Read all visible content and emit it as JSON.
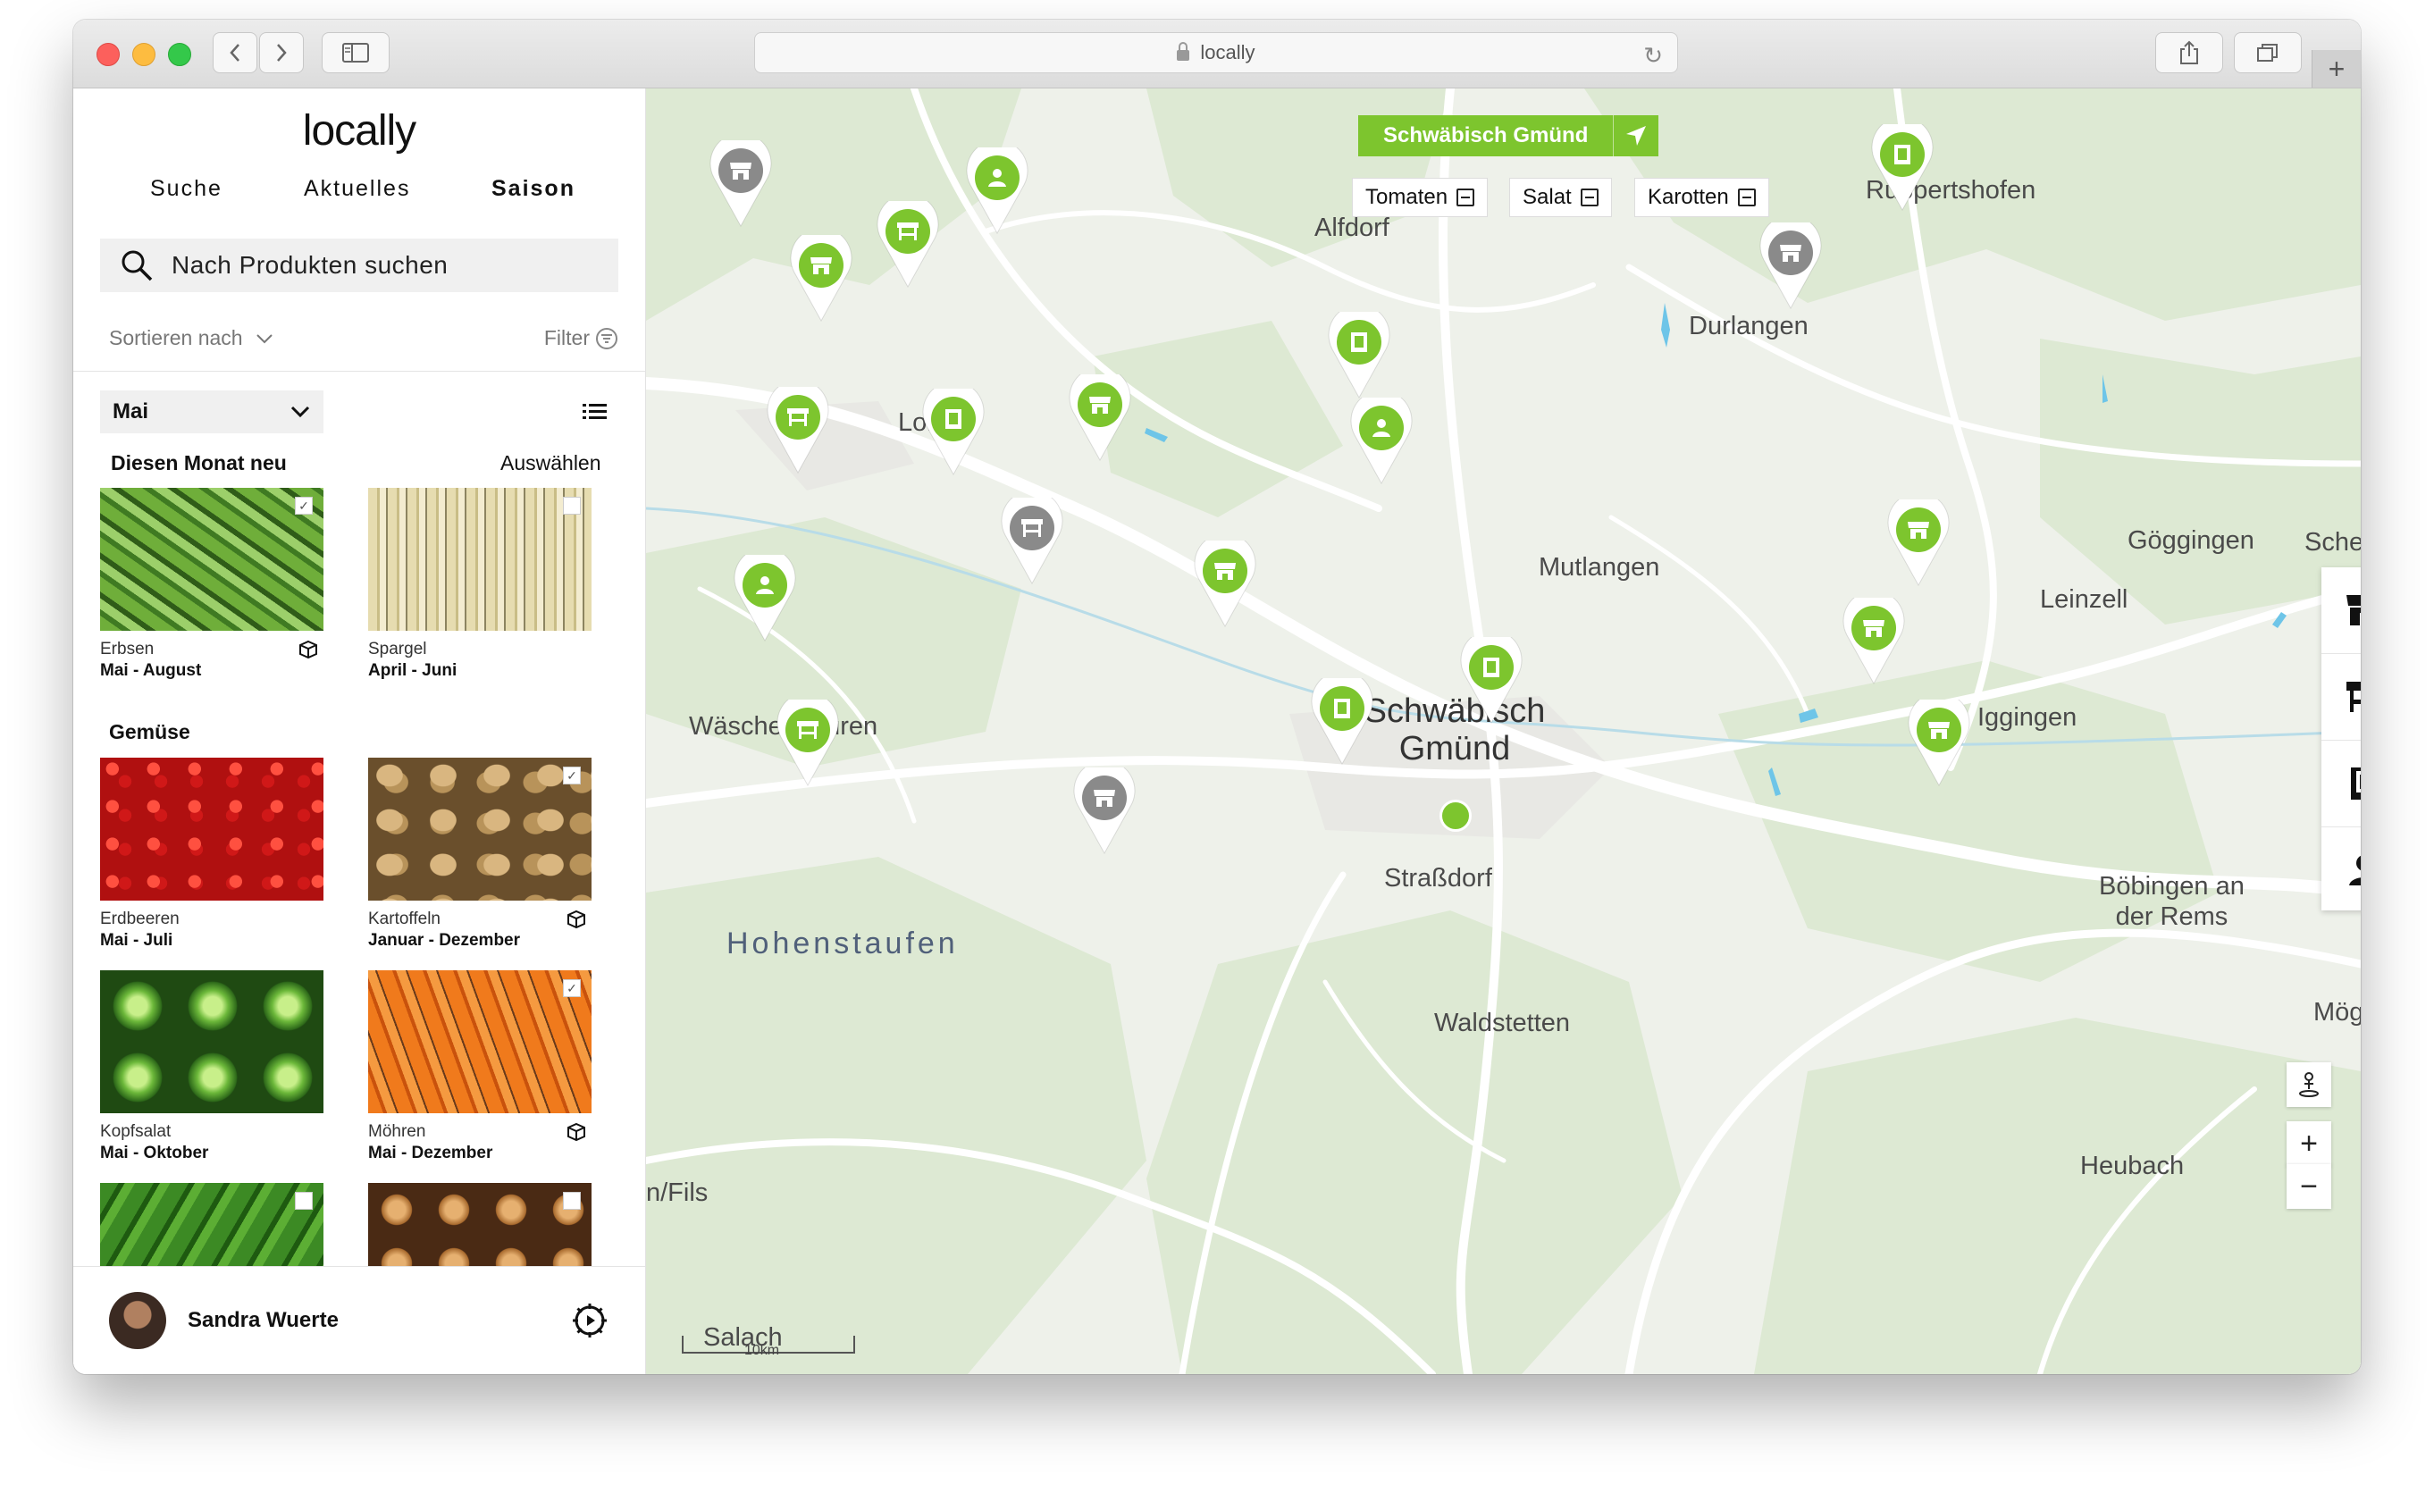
{
  "browser": {
    "url": "locally",
    "new_tab_label": "+"
  },
  "app": {
    "logo": "locally",
    "tabs": [
      {
        "label": "Suche",
        "active": false
      },
      {
        "label": "Aktuelles",
        "active": false
      },
      {
        "label": "Saison",
        "active": true
      }
    ],
    "search_placeholder": "Nach Produkten suchen",
    "sort_label": "Sortieren nach",
    "filter_label": "Filter",
    "month": "Mai",
    "section_new": "Diesen Monat neu",
    "select_label": "Auswählen",
    "section_veg": "Gemüse",
    "new_products": [
      {
        "name": "Erbsen",
        "season": "Mai - August",
        "checked": true,
        "package": true
      },
      {
        "name": "Spargel",
        "season": "April - Juni",
        "checked": false,
        "package": false
      }
    ],
    "veg_products": [
      {
        "name": "Erdbeeren",
        "season": "Mai - Juli",
        "checked": false,
        "package": false
      },
      {
        "name": "Kartoffeln",
        "season": "Januar - Dezember",
        "checked": true,
        "package": true
      },
      {
        "name": "Kopfsalat",
        "season": "Mai - Oktober",
        "checked": false,
        "package": false
      },
      {
        "name": "Möhren",
        "season": "Mai - Dezember",
        "checked": true,
        "package": true
      },
      {
        "name": "",
        "season": "",
        "checked": false,
        "package": false
      },
      {
        "name": "",
        "season": "",
        "checked": false,
        "package": false
      }
    ],
    "user": {
      "name": "Sandra Wuerte"
    }
  },
  "map": {
    "location_button": "Schwäbisch Gmünd",
    "chips": [
      "Tomaten",
      "Salat",
      "Karotten"
    ],
    "places": {
      "alfdorf": "Alfdorf",
      "ruppertshofen": "Ruppertshofen",
      "durlangen": "Durlangen",
      "lorch": "Lorch",
      "mutlangen": "Mutlangen",
      "goeggingen": "Göggingen",
      "schechingen": "Schechinge",
      "leinzell": "Leinzell",
      "waeschenbeuren": "Wäschenbeuren",
      "gmuend_1": "Schwäbisch",
      "gmuend_2": "Gmünd",
      "iggingen": "Iggingen",
      "strassdorf": "Straßdorf",
      "boebingen_1": "Böbingen an",
      "boebingen_2": "der Rems",
      "hohenstaufen": "Hohenstaufen",
      "waldstetten": "Waldstetten",
      "moegglingen": "Mögglinge",
      "fils": "n/Fils",
      "heubach": "Heubach",
      "salach": "Salach"
    },
    "scale_label": "10km",
    "zoom_in": "+",
    "zoom_out": "−",
    "accent_color": "#7dc52e",
    "inactive_color": "#8a8a8a",
    "pins": [
      {
        "type": "shop",
        "color": "gray"
      },
      {
        "type": "farmer",
        "color": "green"
      },
      {
        "type": "stand",
        "color": "green"
      },
      {
        "type": "shop",
        "color": "green"
      },
      {
        "type": "book",
        "color": "green"
      },
      {
        "type": "shop",
        "color": "gray"
      },
      {
        "type": "book",
        "color": "green"
      },
      {
        "type": "stand",
        "color": "green"
      },
      {
        "type": "book",
        "color": "green"
      },
      {
        "type": "shop",
        "color": "green"
      },
      {
        "type": "farmer",
        "color": "green"
      },
      {
        "type": "stand",
        "color": "gray"
      },
      {
        "type": "farmer",
        "color": "green"
      },
      {
        "type": "shop",
        "color": "green"
      },
      {
        "type": "shop",
        "color": "green"
      },
      {
        "type": "shop",
        "color": "green"
      },
      {
        "type": "book",
        "color": "green"
      },
      {
        "type": "book",
        "color": "green"
      },
      {
        "type": "stand",
        "color": "green"
      },
      {
        "type": "shop",
        "color": "green"
      },
      {
        "type": "shop",
        "color": "gray"
      }
    ],
    "type_buttons": [
      "shop-icon",
      "stand-icon",
      "book-icon",
      "farmer-icon"
    ]
  }
}
